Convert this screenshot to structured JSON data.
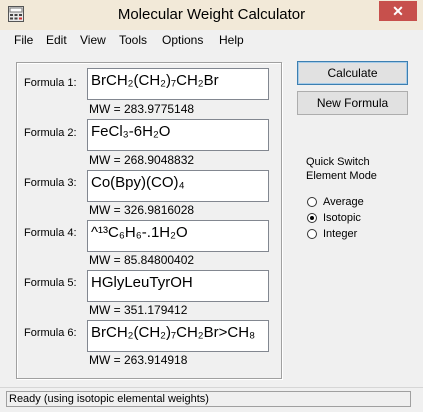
{
  "window": {
    "title": "Molecular Weight Calculator",
    "close_glyph": "✕"
  },
  "menu": [
    "File",
    "Edit",
    "View",
    "Tools",
    "Options",
    "Help"
  ],
  "formulas": [
    {
      "label": "Formula 1:",
      "value": "BrCH₂(CH₂)₇CH₂Br",
      "mw": "MW = 283.9775148"
    },
    {
      "label": "Formula 2:",
      "value": "FeCl₃-6H₂O",
      "mw": "MW = 268.9048832"
    },
    {
      "label": "Formula 3:",
      "value": "Co(Bpy)(CO)₄",
      "mw": "MW = 326.9816028"
    },
    {
      "label": "Formula 4:",
      "value": "^¹³C₆H₆-.1H₂O",
      "mw": "MW = 85.84800402"
    },
    {
      "label": "Formula 5:",
      "value": "HGlyLeuTyrOH",
      "mw": "MW = 351.179412"
    },
    {
      "label": "Formula 6:",
      "value": "BrCH₂(CH₂)₇CH₂Br>CH₈",
      "mw": "MW = 263.914918"
    }
  ],
  "buttons": {
    "calculate": "Calculate",
    "new_formula": "New Formula"
  },
  "quick_switch": {
    "title_line1": "Quick Switch",
    "title_line2": "Element Mode",
    "options": [
      {
        "label": "Average",
        "selected": false
      },
      {
        "label": "Isotopic",
        "selected": true
      },
      {
        "label": "Integer",
        "selected": false
      }
    ]
  },
  "status": "Ready (using isotopic elemental weights)"
}
